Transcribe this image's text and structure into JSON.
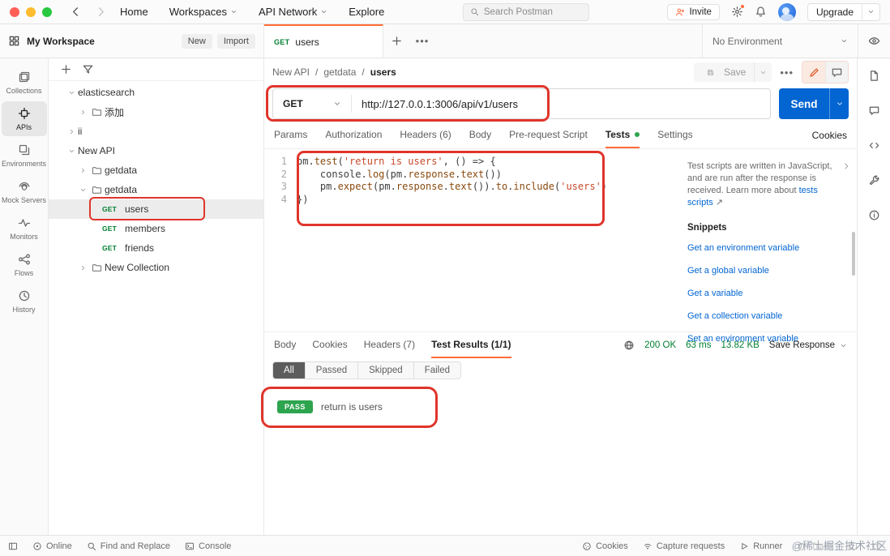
{
  "titlebar": {
    "nav": [
      {
        "label": "Home",
        "dropdown": false
      },
      {
        "label": "Workspaces",
        "dropdown": true
      },
      {
        "label": "API Network",
        "dropdown": true
      },
      {
        "label": "Explore",
        "dropdown": false
      }
    ],
    "search_placeholder": "Search Postman",
    "invite_label": "Invite",
    "upgrade_label": "Upgrade"
  },
  "workspace_bar": {
    "workspace_label": "My Workspace",
    "new_label": "New",
    "import_label": "Import",
    "tab": {
      "method": "GET",
      "title": "users"
    },
    "environment_label": "No Environment"
  },
  "left_rail": [
    {
      "label": "Collections",
      "icon": "collections-icon",
      "active": false
    },
    {
      "label": "APIs",
      "icon": "apis-icon",
      "active": true
    },
    {
      "label": "Environments",
      "icon": "environments-icon",
      "active": false
    },
    {
      "label": "Mock Servers",
      "icon": "mock-servers-icon",
      "active": false
    },
    {
      "label": "Monitors",
      "icon": "monitors-icon",
      "active": false
    },
    {
      "label": "Flows",
      "icon": "flows-icon",
      "active": false
    },
    {
      "label": "History",
      "icon": "history-icon",
      "active": false
    }
  ],
  "tree": [
    {
      "label": "elasticsearch",
      "level": 0,
      "chevron": "down",
      "folder": false
    },
    {
      "label": "添加",
      "level": 1,
      "chevron": "right",
      "folder": true
    },
    {
      "label": "ii",
      "level": 0,
      "chevron": "right",
      "folder": false
    },
    {
      "label": "New API",
      "level": 0,
      "chevron": "down",
      "folder": false
    },
    {
      "label": "getdata",
      "level": 1,
      "chevron": "right",
      "folder": true
    },
    {
      "label": "getdata",
      "level": 1,
      "chevron": "down",
      "folder": true
    },
    {
      "label": "users",
      "level": 2,
      "method": "GET",
      "selected": true
    },
    {
      "label": "members",
      "level": 2,
      "method": "GET"
    },
    {
      "label": "friends",
      "level": 2,
      "method": "GET"
    },
    {
      "label": "New Collection",
      "level": 1,
      "chevron": "right",
      "folder": true
    }
  ],
  "request": {
    "breadcrumb": [
      "New API",
      "getdata",
      "users"
    ],
    "save_label": "Save",
    "method": "GET",
    "url": "http://127.0.0.1:3006/api/v1/users",
    "send_label": "Send",
    "tabs": [
      {
        "label": "Params",
        "active": false,
        "dot": false
      },
      {
        "label": "Authorization",
        "active": false,
        "dot": false
      },
      {
        "label": "Headers (6)",
        "active": false,
        "dot": false
      },
      {
        "label": "Body",
        "active": false,
        "dot": false
      },
      {
        "label": "Pre-request Script",
        "active": false,
        "dot": false
      },
      {
        "label": "Tests",
        "active": true,
        "dot": true
      },
      {
        "label": "Settings",
        "active": false,
        "dot": false
      }
    ],
    "cookies_link": "Cookies"
  },
  "editor": {
    "lines": [
      {
        "n": "1",
        "tokens": [
          [
            "id",
            "pm"
          ],
          [
            "p",
            "."
          ],
          [
            "fn",
            "test"
          ],
          [
            "p",
            "("
          ],
          [
            "str",
            "'return is users'"
          ],
          [
            "p",
            ", () "
          ],
          [
            "kw",
            "=>"
          ],
          [
            "p",
            " {"
          ]
        ]
      },
      {
        "n": "2",
        "tokens": [
          [
            "p",
            "    "
          ],
          [
            "id",
            "console"
          ],
          [
            "p",
            "."
          ],
          [
            "fn",
            "log"
          ],
          [
            "p",
            "("
          ],
          [
            "id",
            "pm"
          ],
          [
            "p",
            "."
          ],
          [
            "prop",
            "response"
          ],
          [
            "p",
            "."
          ],
          [
            "fn",
            "text"
          ],
          [
            "p",
            "())"
          ]
        ]
      },
      {
        "n": "3",
        "tokens": [
          [
            "p",
            "    "
          ],
          [
            "id",
            "pm"
          ],
          [
            "p",
            "."
          ],
          [
            "fn",
            "expect"
          ],
          [
            "p",
            "("
          ],
          [
            "id",
            "pm"
          ],
          [
            "p",
            "."
          ],
          [
            "prop",
            "response"
          ],
          [
            "p",
            "."
          ],
          [
            "fn",
            "text"
          ],
          [
            "p",
            "())."
          ],
          [
            "prop",
            "to"
          ],
          [
            "p",
            "."
          ],
          [
            "fn",
            "include"
          ],
          [
            "p",
            "("
          ],
          [
            "str",
            "'users'"
          ],
          [
            "p",
            ")"
          ]
        ]
      },
      {
        "n": "4",
        "tokens": [
          [
            "p",
            "})"
          ]
        ]
      }
    ]
  },
  "help_panel": {
    "description": "Test scripts are written in JavaScript, and are run after the response is received. Learn more about ",
    "link_label": "tests scripts",
    "external_arrow": "↗",
    "snippets_title": "Snippets",
    "snippets": [
      "Get an environment variable",
      "Get a global variable",
      "Get a variable",
      "Get a collection variable",
      "Set an environment variable"
    ]
  },
  "response": {
    "tabs": [
      {
        "label": "Body",
        "active": false
      },
      {
        "label": "Cookies",
        "active": false
      },
      {
        "label": "Headers (7)",
        "active": false
      },
      {
        "label": "Test Results (1/1)",
        "active": true
      }
    ],
    "status": "200 OK",
    "time": "63 ms",
    "size": "13.82 KB",
    "save_label": "Save Response",
    "filters": [
      {
        "label": "All",
        "active": true
      },
      {
        "label": "Passed",
        "active": false
      },
      {
        "label": "Skipped",
        "active": false
      },
      {
        "label": "Failed",
        "active": false
      }
    ],
    "result": {
      "badge": "PASS",
      "text": "return is users"
    }
  },
  "status_bar": {
    "left": [
      {
        "label": "",
        "icon": "sidebar-toggle-icon"
      },
      {
        "label": "Online",
        "icon": "online-icon"
      },
      {
        "label": "Find and Replace",
        "icon": "search-icon"
      },
      {
        "label": "Console",
        "icon": "console-icon"
      }
    ],
    "right": [
      {
        "label": "Cookies",
        "icon": "cookie-icon"
      },
      {
        "label": "Capture requests",
        "icon": "capture-icon"
      },
      {
        "label": "Runner",
        "icon": "runner-icon"
      },
      {
        "label": "Trash",
        "icon": "trash-icon"
      },
      {
        "label": "",
        "icon": "split-pane-icon"
      },
      {
        "label": "",
        "icon": "help-icon"
      }
    ],
    "watermark": "@稀土掘金技术社区"
  },
  "colors": {
    "accent_orange": "#FF6C37",
    "send_blue": "#0265D2",
    "method_get_green": "#007F31",
    "pass_green": "#2DA44E",
    "annotation_red": "#E0352B"
  }
}
